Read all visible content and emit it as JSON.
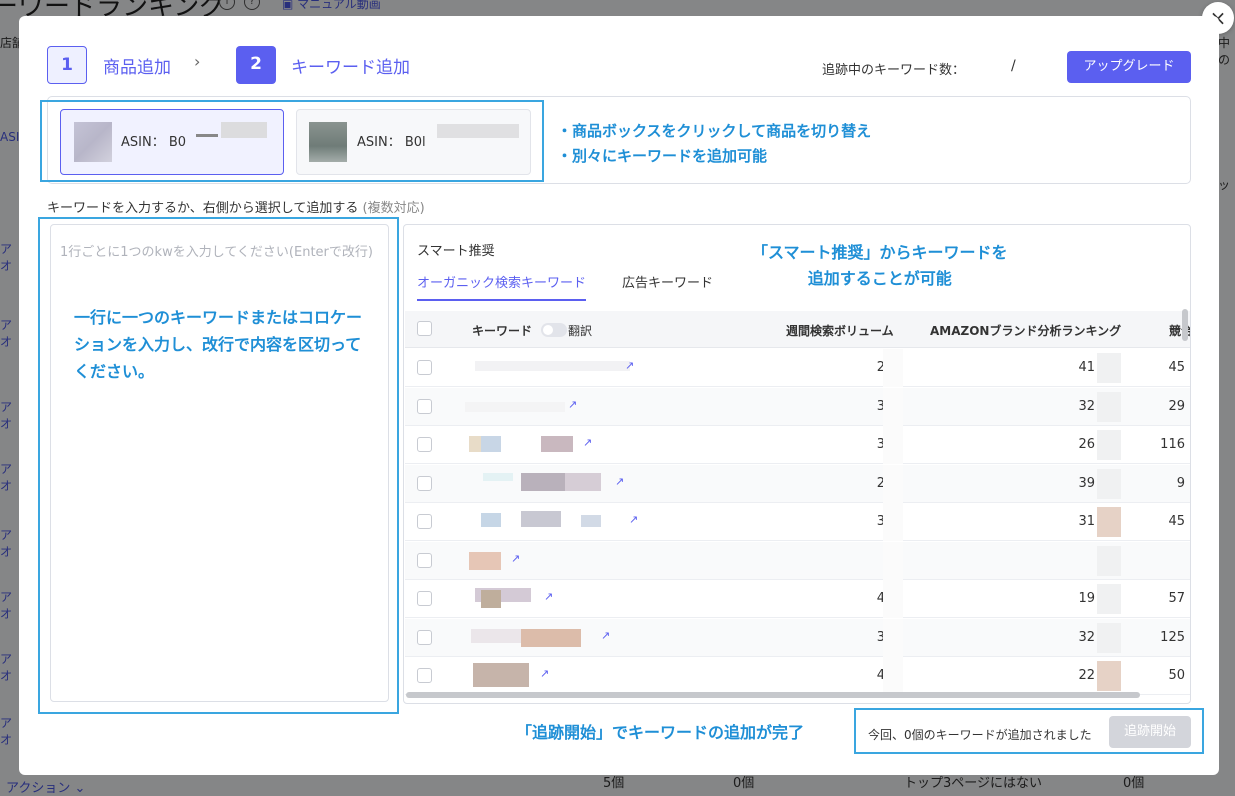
{
  "background": {
    "title": "ーワードランキング",
    "manual_link": "マニュアル動画",
    "col_label": "店舗",
    "asin_label": "ASI",
    "action_label": "アクション",
    "bottom_cells": [
      "5個",
      "0個",
      "トップ3ページにはない",
      "0個"
    ],
    "right_labels": [
      "中の",
      "ッ"
    ]
  },
  "modal": {
    "steps": [
      {
        "num": "1",
        "label": "商品追加"
      },
      {
        "num": "2",
        "label": "キーワード追加"
      }
    ],
    "tracking_label": "追跡中のキーワード数：",
    "tracking_value": "/",
    "upgrade_button": "アップグレード",
    "products": [
      {
        "asin_label": "ASIN：",
        "asin_value": "B0"
      },
      {
        "asin_label": "ASIN：",
        "asin_value": "B0l"
      }
    ],
    "product_note_lines": [
      "・商品ボックスをクリックして商品を切り替え",
      "・別々にキーワードを追加可能"
    ],
    "kw_instruction": "キーワードを入力するか、右側から選択して追加する",
    "kw_instruction_note": "(複数対応)",
    "kw_placeholder": "1行ごとに1つのkwを入力してください(Enterで改行)",
    "kw_note": "一行に一つのキーワードまたはコロケーションを入力し、改行で内容を区切ってください。",
    "smart_title": "スマート推奨",
    "tabs": [
      {
        "label": "オーガニック検索キーワード",
        "active": true
      },
      {
        "label": "広告キーワード",
        "active": false
      }
    ],
    "smart_note_lines": [
      "「スマート推奨」からキーワードを",
      "追加することが可能"
    ],
    "table": {
      "headers": {
        "keyword": "キーワード",
        "translate": "翻訳",
        "volume": "週間検索ボリューム",
        "brand_rank": "AMAZONブランド分析ランキング",
        "competition": "競合"
      },
      "rows": [
        {
          "volume": "2",
          "rank": "41",
          "comp": "45"
        },
        {
          "volume": "3",
          "rank": "32",
          "comp": "29"
        },
        {
          "volume": "3",
          "rank": "26",
          "comp": "116"
        },
        {
          "volume": "2",
          "rank": "39",
          "comp": "9"
        },
        {
          "volume": "3",
          "rank": "31",
          "comp": "45"
        },
        {
          "volume": "",
          "rank": "",
          "comp": ""
        },
        {
          "volume": "4",
          "rank": "19",
          "comp": "57"
        },
        {
          "volume": "3",
          "rank": "32",
          "comp": "125"
        },
        {
          "volume": "4",
          "rank": "22",
          "comp": "50"
        }
      ]
    },
    "footer_note": "「追跡開始」でキーワードの追加が完了",
    "footer_text": "今回、0個のキーワードが追加されました",
    "start_button": "追跡開始",
    "close_icon": "×"
  },
  "colors": {
    "accent": "#5b5ff0",
    "annotation": "#3aa6e0",
    "annotation_text": "#1f8fd6"
  }
}
